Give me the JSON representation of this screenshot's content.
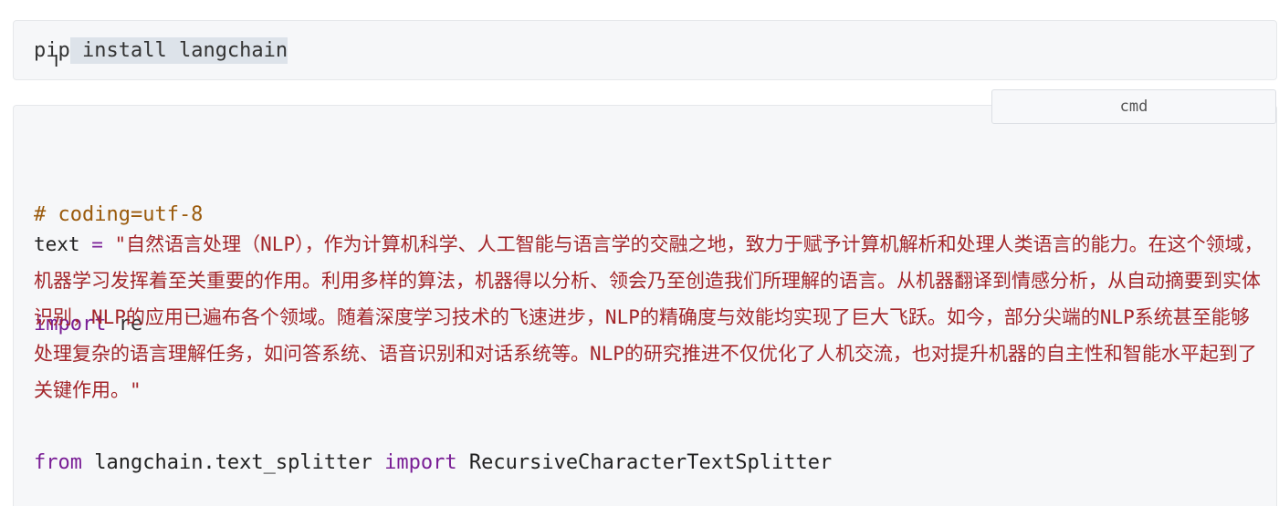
{
  "pip_block": {
    "cmd_prefix": "pip",
    "cmd_selected": " install langchain",
    "language_label": "cmd"
  },
  "python_block": {
    "line1": "# coding=utf-8",
    "line2_kw": "import",
    "line2_rest": " re",
    "text_var": "text",
    "text_eq": " = ",
    "text_string": "\"自然语言处理（NLP），作为计算机科学、人工智能与语言学的交融之地，致力于赋予计算机解析和处理人类语言的能力。在这个领域，机器学习发挥着至关重要的作用。利用多样的算法，机器得以分析、领会乃至创造我们所理解的语言。从机器翻译到情感分析，从自动摘要到实体识别，NLP的应用已遍布各个领域。随着深度学习技术的飞速进步，NLP的精确度与效能均实现了巨大飞跃。如今，部分尖端的NLP系统甚至能够处理复杂的语言理解任务，如问答系统、语音识别和对话系统等。NLP的研究推进不仅优化了人机交流，也对提升机器的自主性和智能水平起到了关键作用。\"",
    "from_kw": "from",
    "from_module": " langchain.text_splitter ",
    "import_kw": "import",
    "import_name": " RecursiveCharacterTextSplitter"
  }
}
